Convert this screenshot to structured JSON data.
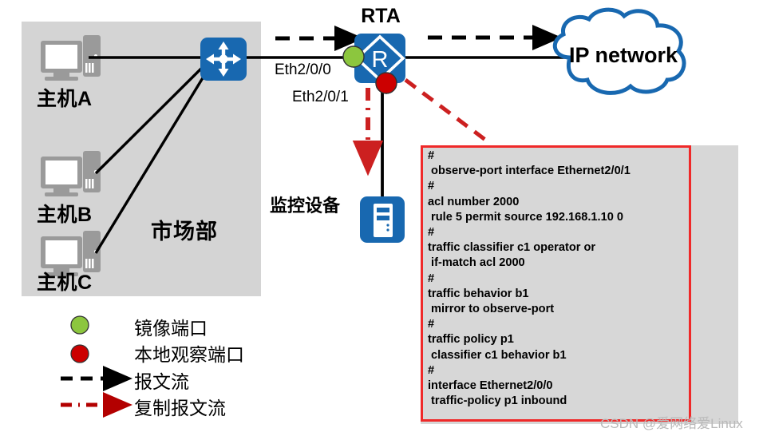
{
  "diagram": {
    "department": {
      "label": "市场部",
      "hosts": [
        {
          "name": "主机A"
        },
        {
          "name": "主机B"
        },
        {
          "name": "主机C"
        }
      ]
    },
    "router": {
      "name": "RTA",
      "glyph": "R",
      "interfaces": [
        {
          "label": "Eth2/0/0",
          "role": "mirror-port",
          "marker_color": "#8cc63e"
        },
        {
          "label": "Eth2/0/1",
          "role": "observe-port",
          "marker_color": "#cc0000"
        }
      ]
    },
    "monitor": {
      "label": "监控设备"
    },
    "cloud": {
      "label": "IP network"
    },
    "colors": {
      "device_blue": "#1868b0",
      "zone_gray": "#d4d4d4",
      "panel_gray": "#d7d7d7",
      "panel_border_red": "#ef2929",
      "flow_black": "#000000",
      "mirror_red": "#cc2020",
      "mirror_green": "#8cc63e",
      "observe_red": "#cc0000",
      "pc_gray": "#9a9a9a"
    }
  },
  "legend": {
    "items": [
      {
        "label": "镜像端口",
        "marker": "green-dot"
      },
      {
        "label": "本地观察端口",
        "marker": "red-dot"
      },
      {
        "label": "报文流",
        "marker": "black-dashed-arrow"
      },
      {
        "label": "复制报文流",
        "marker": "red-dashdot-arrow"
      }
    ]
  },
  "config_panel": {
    "lines": [
      "#",
      " observe-port interface Ethernet2/0/1",
      "#",
      "acl number 2000",
      " rule 5 permit source 192.168.1.10 0",
      "#",
      "traffic classifier c1 operator or",
      " if-match acl 2000",
      "#",
      "traffic behavior b1",
      " mirror to observe-port",
      "#",
      "traffic policy p1",
      " classifier c1 behavior b1",
      "#",
      "interface Ethernet2/0/0",
      " traffic-policy p1 inbound"
    ]
  },
  "watermark": {
    "text": "CSDN @爱网络爱Linux"
  }
}
